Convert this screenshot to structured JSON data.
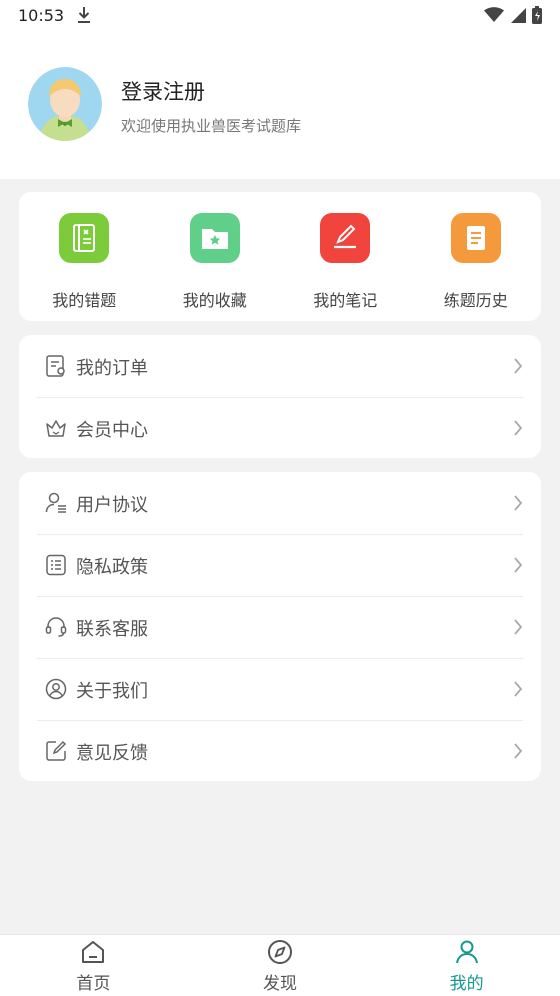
{
  "status": {
    "time": "10:53"
  },
  "profile": {
    "title": "登录注册",
    "subtitle": "欢迎使用执业兽医考试题库"
  },
  "quick_actions": [
    {
      "label": "我的错题",
      "icon": "notebook-icon",
      "color": "#7ccb3a"
    },
    {
      "label": "我的收藏",
      "icon": "folder-star-icon",
      "color": "#5fcf8a"
    },
    {
      "label": "我的笔记",
      "icon": "pencil-note-icon",
      "color": "#f0443c"
    },
    {
      "label": "练题历史",
      "icon": "history-book-icon",
      "color": "#f59a3c"
    }
  ],
  "group1": [
    {
      "label": "我的订单",
      "icon": "order-receipt-icon"
    },
    {
      "label": "会员中心",
      "icon": "crown-icon"
    }
  ],
  "group2": [
    {
      "label": "用户协议",
      "icon": "user-agreement-icon"
    },
    {
      "label": "隐私政策",
      "icon": "privacy-list-icon"
    },
    {
      "label": "联系客服",
      "icon": "headset-icon"
    },
    {
      "label": "关于我们",
      "icon": "about-user-icon"
    },
    {
      "label": "意见反馈",
      "icon": "feedback-edit-icon"
    }
  ],
  "tabs": [
    {
      "label": "首页",
      "icon": "home-icon"
    },
    {
      "label": "发现",
      "icon": "compass-icon"
    },
    {
      "label": "我的",
      "icon": "person-icon",
      "active": true
    }
  ],
  "colors": {
    "accent": "#169a8f",
    "background": "#f2f2f2"
  }
}
